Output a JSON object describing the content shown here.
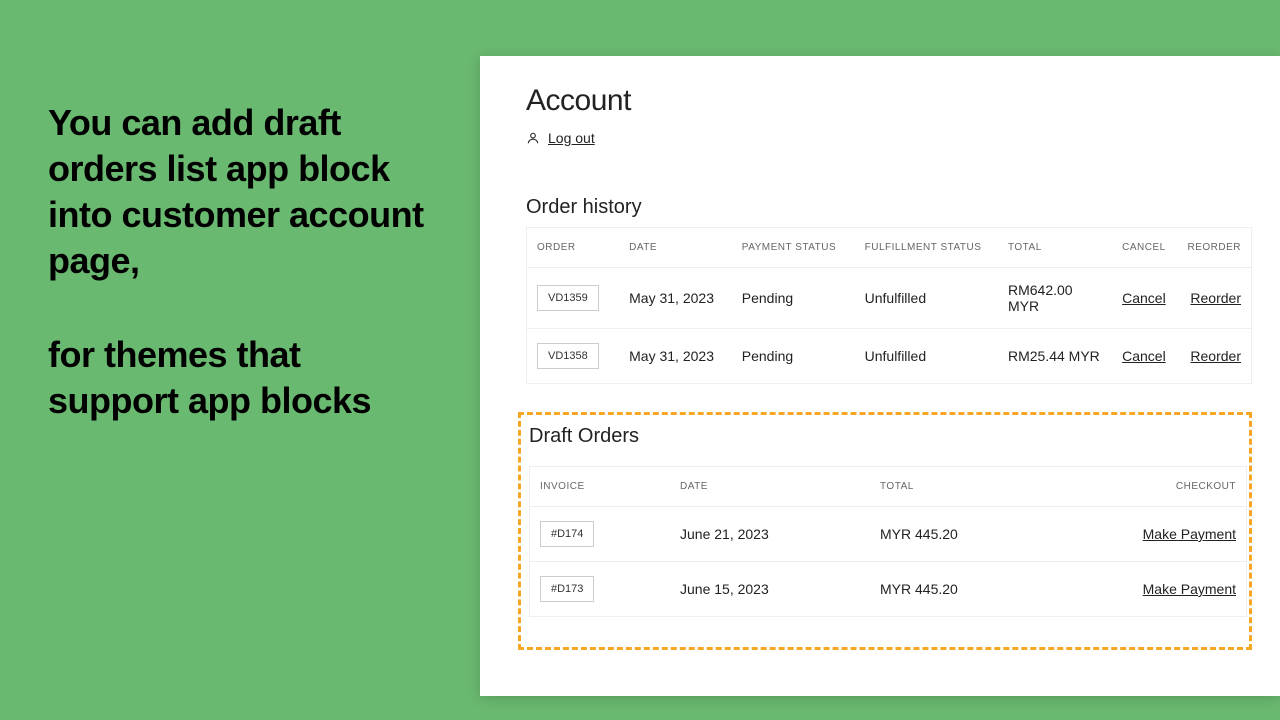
{
  "promo": {
    "line1": "You can add draft orders list app block into customer account page,",
    "line2": "for themes that support app blocks"
  },
  "header": {
    "title": "Account",
    "logout": "Log out"
  },
  "order_history": {
    "title": "Order history",
    "columns": {
      "order": "ORDER",
      "date": "DATE",
      "payment": "PAYMENT STATUS",
      "fulfillment": "FULFILLMENT STATUS",
      "total": "TOTAL",
      "cancel": "CANCEL",
      "reorder": "REORDER"
    },
    "rows": [
      {
        "id": "VD1359",
        "date": "May 31, 2023",
        "payment": "Pending",
        "fulfillment": "Unfulfilled",
        "total": "RM642.00 MYR",
        "cancel": "Cancel",
        "reorder": "Reorder"
      },
      {
        "id": "VD1358",
        "date": "May 31, 2023",
        "payment": "Pending",
        "fulfillment": "Unfulfilled",
        "total": "RM25.44 MYR",
        "cancel": "Cancel",
        "reorder": "Reorder"
      }
    ]
  },
  "draft_orders": {
    "title": "Draft Orders",
    "columns": {
      "invoice": "INVOICE",
      "date": "DATE",
      "total": "TOTAL",
      "checkout": "CHECKOUT"
    },
    "rows": [
      {
        "id": "#D174",
        "date": "June 21, 2023",
        "total": "MYR 445.20",
        "action": "Make Payment"
      },
      {
        "id": "#D173",
        "date": "June 15, 2023",
        "total": "MYR 445.20",
        "action": "Make Payment"
      }
    ]
  }
}
